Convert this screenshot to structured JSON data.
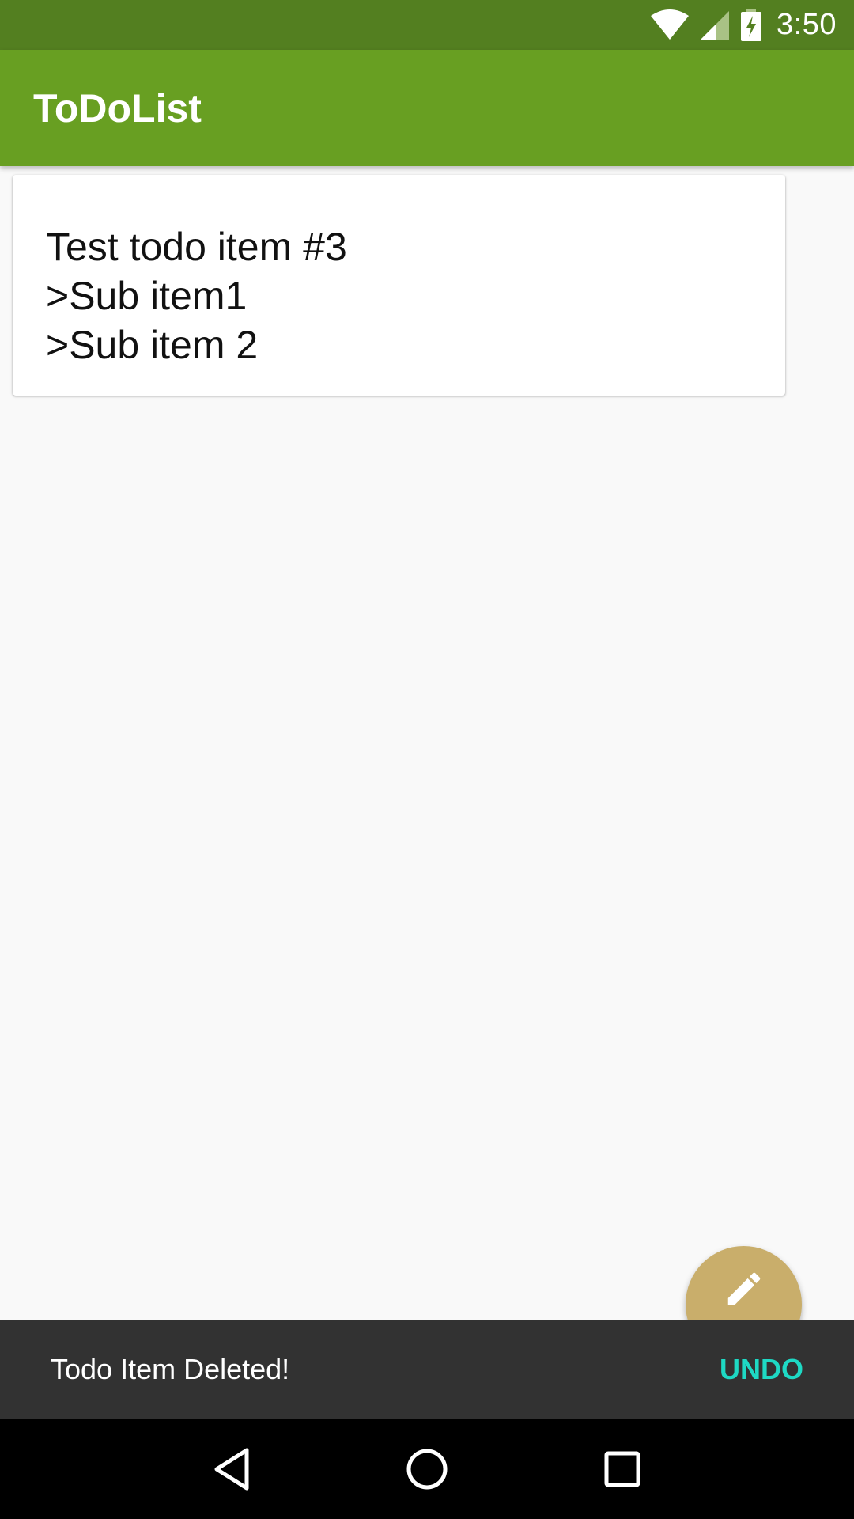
{
  "status_bar": {
    "time": "3:50",
    "icons": [
      "wifi-icon",
      "cellular-signal-icon",
      "battery-charging-icon"
    ]
  },
  "app_bar": {
    "title": "ToDoList"
  },
  "todo_items": [
    {
      "lines": [
        "Test todo item #3",
        ">Sub item1",
        ">Sub item 2"
      ]
    }
  ],
  "fab": {
    "icon": "edit-pencil-icon",
    "color": "#c9ae6b"
  },
  "snackbar": {
    "message": "Todo Item Deleted!",
    "action_label": "UNDO",
    "action_color": "#1ed9c4"
  },
  "nav_bar": {
    "buttons": [
      "back-icon",
      "home-icon",
      "recents-icon"
    ]
  },
  "colors": {
    "status_bar": "#537f20",
    "app_bar": "#689f22",
    "background": "#f9f9f9",
    "snackbar": "#323232"
  }
}
